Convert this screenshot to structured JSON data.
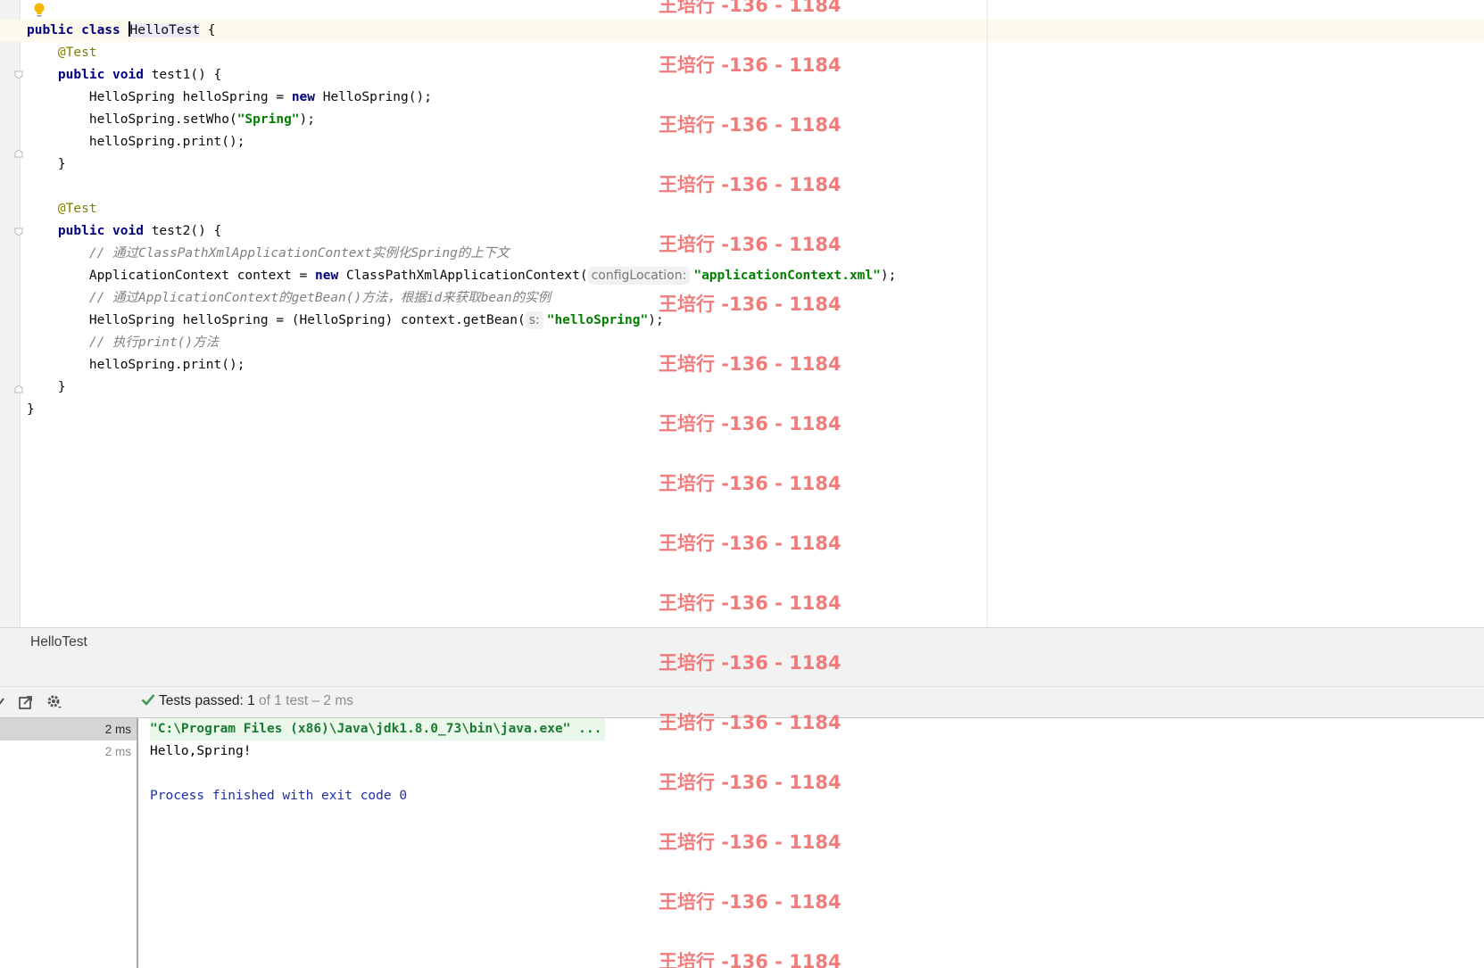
{
  "editor": {
    "lines": [
      [
        {
          "t": "public class ",
          "c": "kw"
        },
        {
          "t": "",
          "c": "caret"
        },
        {
          "t": "HelloTest",
          "c": "cls-hl"
        },
        {
          "t": " {",
          "c": ""
        }
      ],
      [
        {
          "t": "    @Test",
          "c": "ann"
        }
      ],
      [
        {
          "t": "    ",
          "c": ""
        },
        {
          "t": "public void ",
          "c": "kw"
        },
        {
          "t": "test1() {",
          "c": ""
        }
      ],
      [
        {
          "t": "        HelloSpring helloSpring = ",
          "c": ""
        },
        {
          "t": "new ",
          "c": "kw"
        },
        {
          "t": "HelloSpring();",
          "c": ""
        }
      ],
      [
        {
          "t": "        helloSpring.setWho(",
          "c": ""
        },
        {
          "t": "\"Spring\"",
          "c": "str"
        },
        {
          "t": ");",
          "c": ""
        }
      ],
      [
        {
          "t": "        helloSpring.print();",
          "c": ""
        }
      ],
      [
        {
          "t": "    }",
          "c": ""
        }
      ],
      [
        {
          "t": "",
          "c": ""
        }
      ],
      [
        {
          "t": "    @Test",
          "c": "ann"
        }
      ],
      [
        {
          "t": "    ",
          "c": ""
        },
        {
          "t": "public void ",
          "c": "kw"
        },
        {
          "t": "test2() {",
          "c": ""
        }
      ],
      [
        {
          "t": "        // 通过ClassPathXmlApplicationContext实例化Spring的上下文",
          "c": "cm"
        }
      ],
      [
        {
          "t": "        ApplicationContext context = ",
          "c": ""
        },
        {
          "t": "new ",
          "c": "kw"
        },
        {
          "t": "ClassPathXmlApplicationContext(",
          "c": ""
        },
        {
          "t": "configLocation:",
          "c": "hint"
        },
        {
          "t": "\"applicationContext.xml\"",
          "c": "str"
        },
        {
          "t": ");",
          "c": ""
        }
      ],
      [
        {
          "t": "        // 通过ApplicationContext的getBean()方法，根据id来获取bean的实例",
          "c": "cm"
        }
      ],
      [
        {
          "t": "        HelloSpring helloSpring = (HelloSpring) context.getBean(",
          "c": ""
        },
        {
          "t": "s:",
          "c": "hint"
        },
        {
          "t": "\"helloSpring\"",
          "c": "str"
        },
        {
          "t": ");",
          "c": ""
        }
      ],
      [
        {
          "t": "        // 执行print()方法",
          "c": "cm"
        }
      ],
      [
        {
          "t": "        helloSpring.print();",
          "c": ""
        }
      ],
      [
        {
          "t": "    }",
          "c": ""
        }
      ],
      [
        {
          "t": "}",
          "c": ""
        }
      ]
    ]
  },
  "run": {
    "tab_title": "HelloTest",
    "tests_status": {
      "prefix": "Tests passed: ",
      "passed": "1",
      "suffix": " of 1 test – 2 ms"
    },
    "tree": [
      {
        "duration": "2 ms",
        "selected": true
      },
      {
        "duration": "2 ms",
        "selected": false
      }
    ],
    "console": {
      "command": "\"C:\\Program Files (x86)\\Java\\jdk1.8.0_73\\bin\\java.exe\" ...",
      "output": "Hello,Spring!",
      "exit": "Process finished with exit code 0"
    }
  },
  "watermark": {
    "text": "王培行 -136 - 1184",
    "count": 17
  },
  "icons": {
    "bulb": "lightbulb-icon",
    "export": "export-icon",
    "settings": "gear-icon",
    "check": "check-icon"
  }
}
